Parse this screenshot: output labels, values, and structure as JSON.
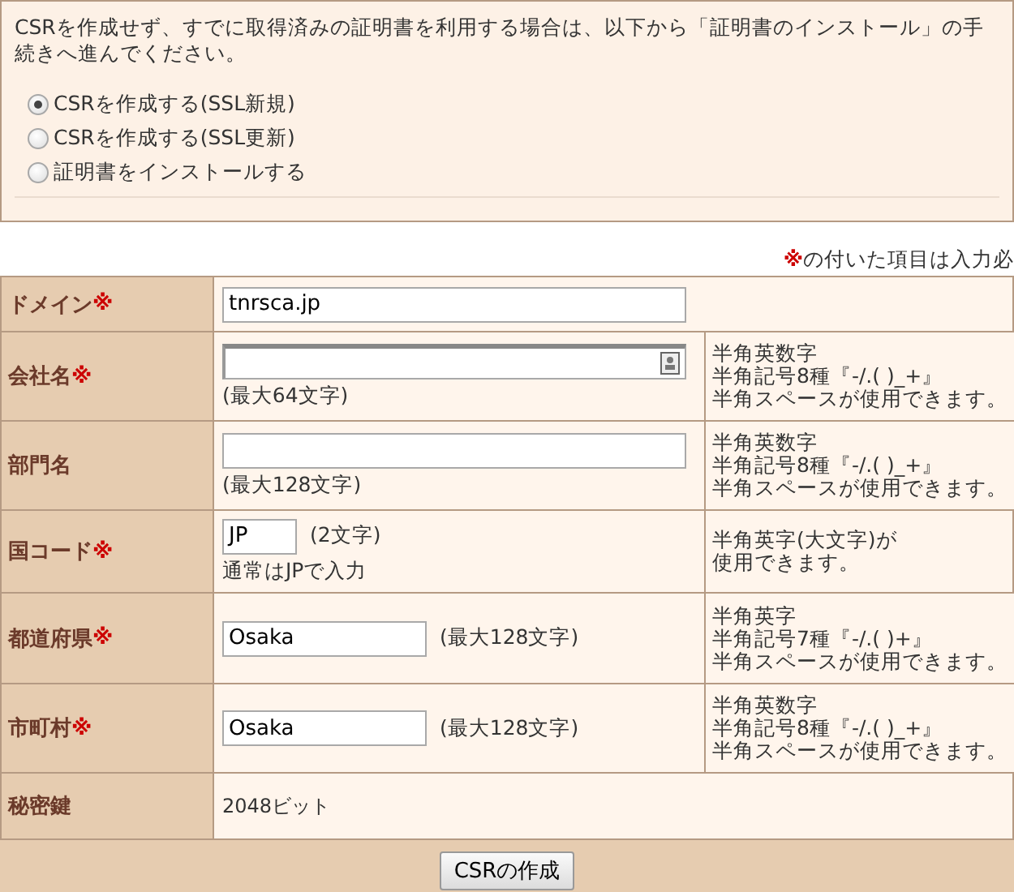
{
  "intro": "CSRを作成せず、すでに取得済みの証明書を利用する場合は、以下から「証明書のインストール」の手続きへ進んでください。",
  "options": [
    {
      "label": "CSRを作成する(SSL新規)",
      "selected": true
    },
    {
      "label": "CSRを作成する(SSL更新)",
      "selected": false
    },
    {
      "label": "証明書をインストールする",
      "selected": false
    }
  ],
  "required_note": {
    "mark": "※",
    "text": "の付いた項目は入力必"
  },
  "fields": [
    {
      "label": "ドメイン",
      "required_mark": "※",
      "kind": "wide",
      "value": "tnrsca.jp"
    },
    {
      "label": "会社名",
      "required_mark": "※",
      "kind": "wide",
      "autofill": true,
      "hint_below": "(最大64文字)",
      "notes": [
        "半角英数字",
        "半角記号8種『-/.( )_+』",
        "半角スペースが使用できます。"
      ]
    },
    {
      "label": "部門名",
      "kind": "wide",
      "hint_below": "(最大128文字)",
      "notes": [
        "半角英数字",
        "半角記号8種『-/.( )_+』",
        "半角スペースが使用できます。"
      ]
    },
    {
      "label": "国コード",
      "required_mark": "※",
      "kind": "short",
      "value": "JP",
      "hint_inline": "(2文字)",
      "hint_below": "通常はJPで入力",
      "notes": [
        "半角英字(大文字)が",
        "使用できます。"
      ]
    },
    {
      "label": "都道府県",
      "required_mark": "※",
      "kind": "medium",
      "value": "Osaka",
      "hint_inline": "(最大128文字)",
      "notes": [
        "半角英字",
        "半角記号7種『-/.( )+』",
        "半角スペースが使用できます。"
      ]
    },
    {
      "label": "市町村",
      "required_mark": "※",
      "kind": "medium",
      "value": "Osaka",
      "hint_inline": "(最大128文字)",
      "notes": [
        "半角英数字",
        "半角記号8種『-/.( )_+』",
        "半角スペースが使用できます。"
      ]
    },
    {
      "label": "秘密鍵",
      "kind": "static",
      "value": "2048ビット"
    }
  ],
  "submit": "CSRの作成"
}
